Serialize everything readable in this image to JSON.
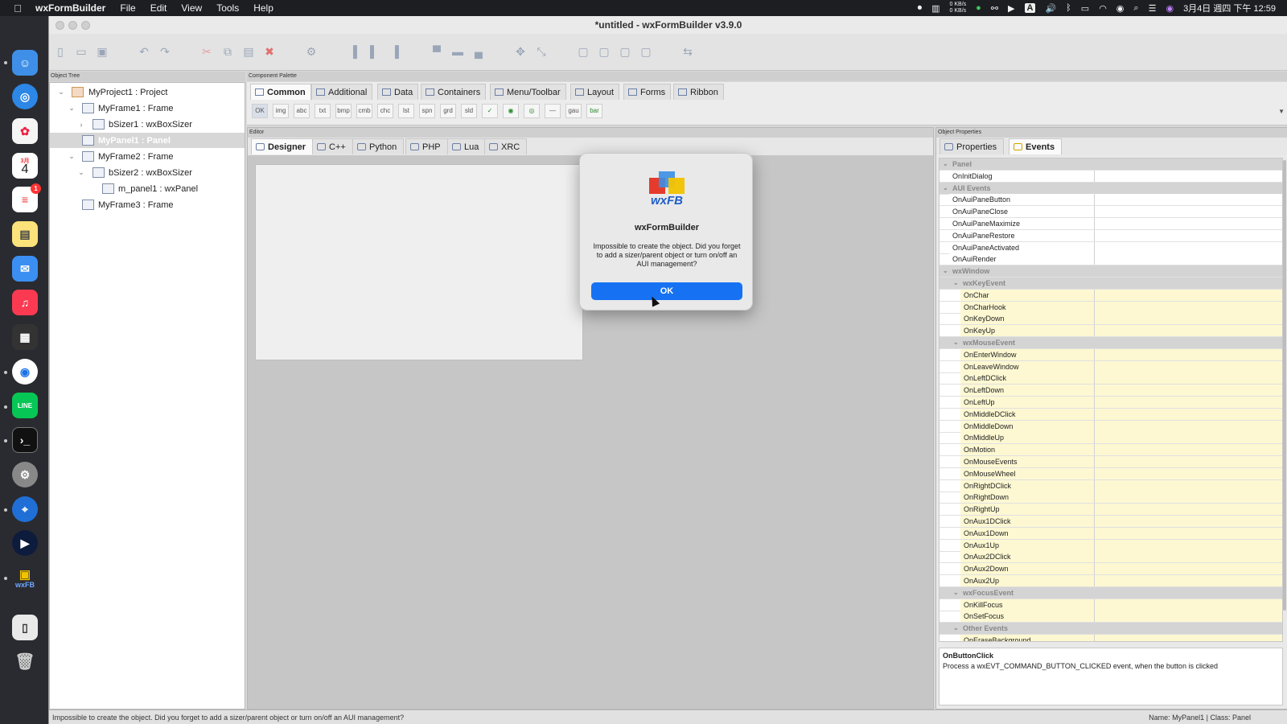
{
  "menubar": {
    "app": "wxFormBuilder",
    "menus": [
      "File",
      "Edit",
      "View",
      "Tools",
      "Help"
    ],
    "net_up": "0 KB/s",
    "net_down": "0 KB/s",
    "input_badge": "A",
    "clock": "3月4日 週四 下午 12:59"
  },
  "dock": {
    "calendar_month": "3月",
    "calendar_day": "4",
    "reminders_badge": "1",
    "line_label": "LINE",
    "wxfb_label": "wxFB"
  },
  "window": {
    "title": "*untitled - wxFormBuilder v3.9.0"
  },
  "panels": {
    "object_tree": "Object Tree",
    "component_palette": "Component Palette",
    "editor": "Editor",
    "object_properties": "Object Properties"
  },
  "tree": [
    {
      "label": "MyProject1 : Project",
      "toggle": "⌄"
    },
    {
      "label": "MyFrame1 : Frame",
      "toggle": "⌄"
    },
    {
      "label": "bSizer1 : wxBoxSizer",
      "toggle": "›"
    },
    {
      "label": "MyPanel1 : Panel",
      "toggle": ""
    },
    {
      "label": "MyFrame2 : Frame",
      "toggle": "⌄"
    },
    {
      "label": "bSizer2 : wxBoxSizer",
      "toggle": "⌄"
    },
    {
      "label": "m_panel1 : wxPanel",
      "toggle": ""
    },
    {
      "label": "MyFrame3 : Frame",
      "toggle": ""
    }
  ],
  "palette_tabs": [
    "Common",
    "Additional",
    "Data",
    "Containers",
    "Menu/Toolbar",
    "Layout",
    "Forms",
    "Ribbon"
  ],
  "palette_icons": [
    "OK",
    "img",
    "abc",
    "txt",
    "bmp",
    "cmb",
    "chc",
    "lst",
    "spn",
    "grd",
    "sld",
    "✓",
    "◉",
    "◎",
    "—",
    "gau",
    "bar"
  ],
  "editor_tabs": [
    "Designer",
    "C++",
    "Python",
    "PHP",
    "Lua",
    "XRC"
  ],
  "props_tabs": [
    "Properties",
    "Events"
  ],
  "events": {
    "panel_cat": "Panel",
    "panel_items": [
      "OnInitDialog"
    ],
    "aui_cat": "AUI Events",
    "aui_items": [
      "OnAuiPaneButton",
      "OnAuiPaneClose",
      "OnAuiPaneMaximize",
      "OnAuiPaneRestore",
      "OnAuiPaneActivated",
      "OnAuiRender"
    ],
    "wxwindow_cat": "wxWindow",
    "key_cat": "wxKeyEvent",
    "key_items": [
      "OnChar",
      "OnCharHook",
      "OnKeyDown",
      "OnKeyUp"
    ],
    "mouse_cat": "wxMouseEvent",
    "mouse_items": [
      "OnEnterWindow",
      "OnLeaveWindow",
      "OnLeftDClick",
      "OnLeftDown",
      "OnLeftUp",
      "OnMiddleDClick",
      "OnMiddleDown",
      "OnMiddleUp",
      "OnMotion",
      "OnMouseEvents",
      "OnMouseWheel",
      "OnRightDClick",
      "OnRightDown",
      "OnRightUp",
      "OnAux1DClick",
      "OnAux1Down",
      "OnAux1Up",
      "OnAux2DClick",
      "OnAux2Down",
      "OnAux2Up"
    ],
    "focus_cat": "wxFocusEvent",
    "focus_items": [
      "OnKillFocus",
      "OnSetFocus"
    ],
    "other_cat": "Other Events",
    "other_items": [
      "OnEraseBackground"
    ]
  },
  "description": {
    "title": "OnButtonClick",
    "text": "Process a wxEVT_COMMAND_BUTTON_CLICKED event, when the button is clicked"
  },
  "statusbar": {
    "message": "Impossible to create the object. Did you forget to add a sizer/parent object or turn on/off an AUI management?",
    "info": "Name: MyPanel1 | Class: Panel"
  },
  "dialog": {
    "logo_text": "wxFB",
    "title": "wxFormBuilder",
    "message": "Impossible to create the object. Did you forget to add a sizer/parent object or turn on/off an AUI management?",
    "ok": "OK"
  },
  "colors": {
    "accent": "#1672f3",
    "event_highlight": "#fdf8d2"
  }
}
